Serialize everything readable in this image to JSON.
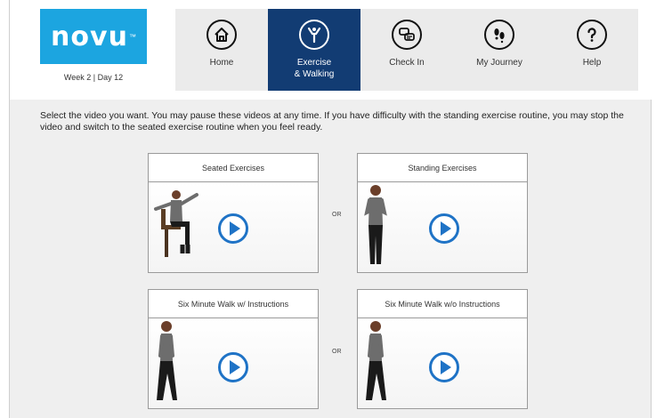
{
  "brand": {
    "logo_text": "novu",
    "trademark": "™",
    "week_day": "Week 2 | Day 12",
    "logo_color": "#1ca5e0"
  },
  "nav": {
    "active_color": "#123c73",
    "items": [
      {
        "label": "Home",
        "icon": "home-icon"
      },
      {
        "label": "Exercise\n& Walking",
        "icon": "exercise-icon"
      },
      {
        "label": "Check In",
        "icon": "chat-icon"
      },
      {
        "label": "My Journey",
        "icon": "footprints-icon"
      },
      {
        "label": "Help",
        "icon": "help-icon"
      }
    ]
  },
  "instructions": "Select the video you want. You may pause these videos at any time. If you have difficulty with the standing exercise routine, you may stop the video and switch to the seated exercise routine when you feel ready.",
  "videos": {
    "seated": {
      "title": "Seated Exercises"
    },
    "standing": {
      "title": "Standing Exercises"
    },
    "walk_with": {
      "title": "Six Minute Walk w/ Instructions"
    },
    "walk_without": {
      "title": "Six Minute Walk w/o Instructions"
    }
  },
  "or_labels": [
    "OR",
    "OR"
  ],
  "play_color": "#1f73c6"
}
